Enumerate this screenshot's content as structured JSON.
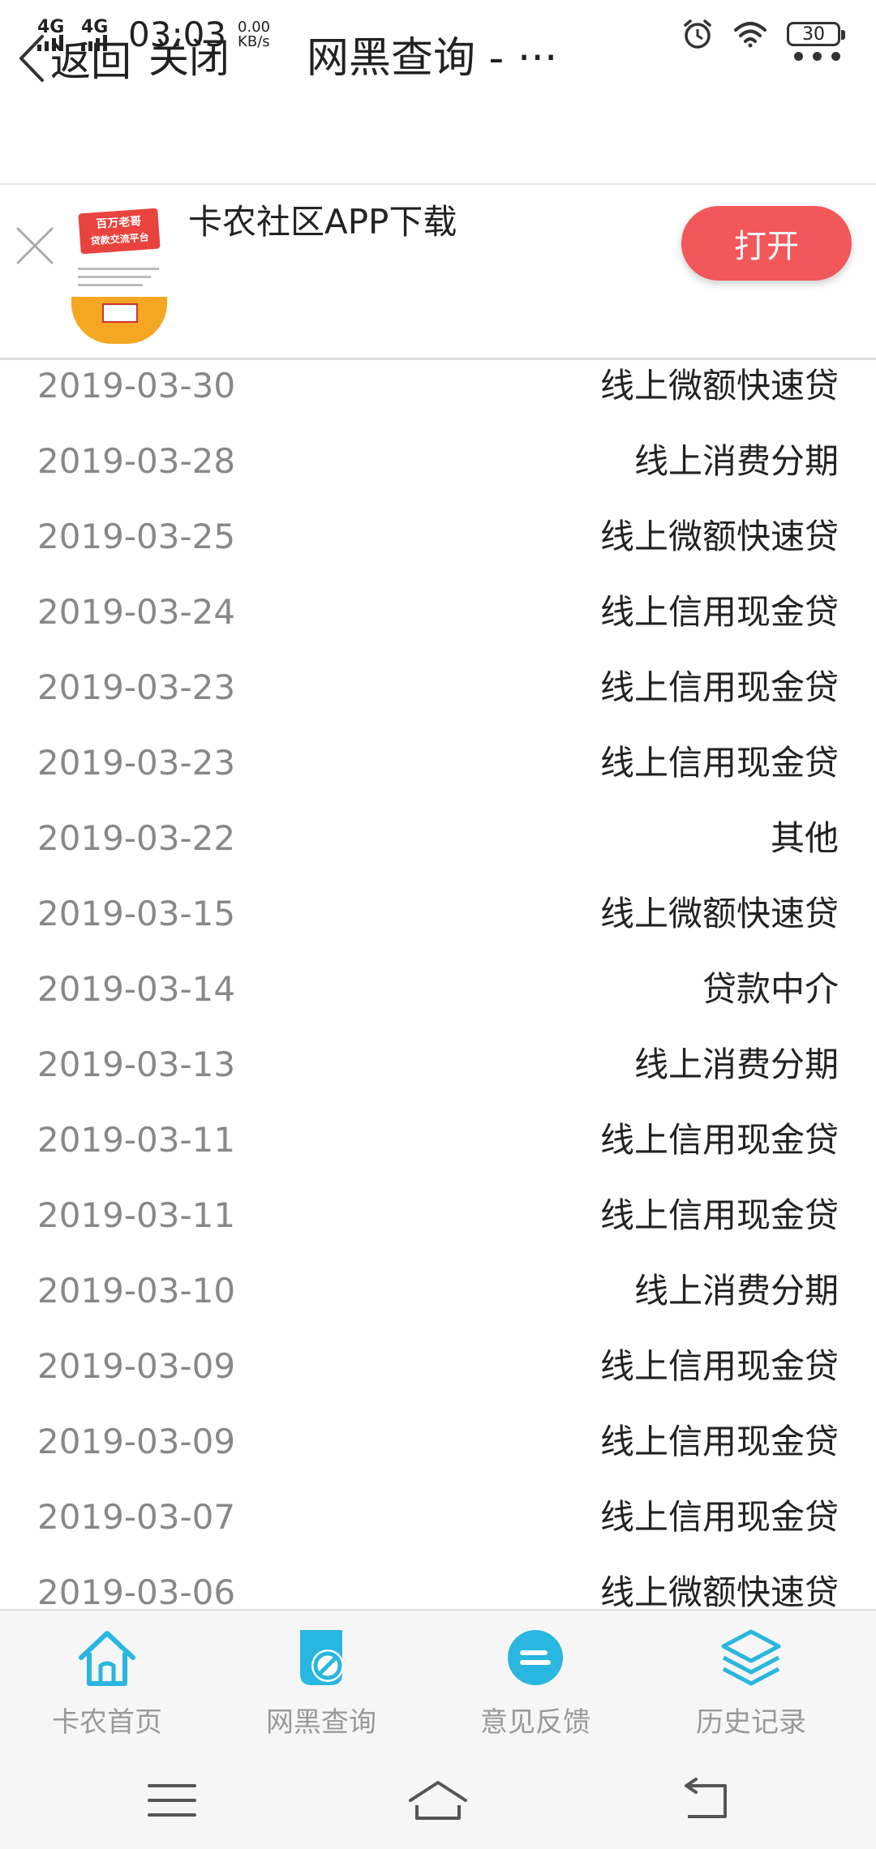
{
  "status_bar": {
    "net1": "4G",
    "net2": "4G",
    "time": "03:03",
    "speed_value": "0.00",
    "speed_unit": "KB/s",
    "battery": "30"
  },
  "nav": {
    "back_label": "返回",
    "close_label": "关闭",
    "title": "网黑查询 - ···"
  },
  "banner": {
    "app_thumb_text": "百万老哥",
    "app_thumb_text2": "贷款交流平台",
    "title": "卡农社区APP下载",
    "open_label": "打开"
  },
  "records": [
    {
      "date": "2019-03-30",
      "type": "线上微额快速贷"
    },
    {
      "date": "2019-03-28",
      "type": "线上消费分期"
    },
    {
      "date": "2019-03-25",
      "type": "线上微额快速贷"
    },
    {
      "date": "2019-03-24",
      "type": "线上信用现金贷"
    },
    {
      "date": "2019-03-23",
      "type": "线上信用现金贷"
    },
    {
      "date": "2019-03-23",
      "type": "线上信用现金贷"
    },
    {
      "date": "2019-03-22",
      "type": "其他"
    },
    {
      "date": "2019-03-15",
      "type": "线上微额快速贷"
    },
    {
      "date": "2019-03-14",
      "type": "贷款中介"
    },
    {
      "date": "2019-03-13",
      "type": "线上消费分期"
    },
    {
      "date": "2019-03-11",
      "type": "线上信用现金贷"
    },
    {
      "date": "2019-03-11",
      "type": "线上信用现金贷"
    },
    {
      "date": "2019-03-10",
      "type": "线上消费分期"
    },
    {
      "date": "2019-03-09",
      "type": "线上信用现金贷"
    },
    {
      "date": "2019-03-09",
      "type": "线上信用现金贷"
    },
    {
      "date": "2019-03-07",
      "type": "线上信用现金贷"
    },
    {
      "date": "2019-03-06",
      "type": "线上微额快速贷"
    }
  ],
  "tabs": [
    {
      "label": "卡农首页",
      "icon": "home-icon"
    },
    {
      "label": "网黑查询",
      "icon": "blacklist-query-icon"
    },
    {
      "label": "意见反馈",
      "icon": "feedback-icon"
    },
    {
      "label": "历史记录",
      "icon": "layers-icon"
    }
  ],
  "colors": {
    "accent": "#29b6e0",
    "open_button": "#f2575a"
  }
}
